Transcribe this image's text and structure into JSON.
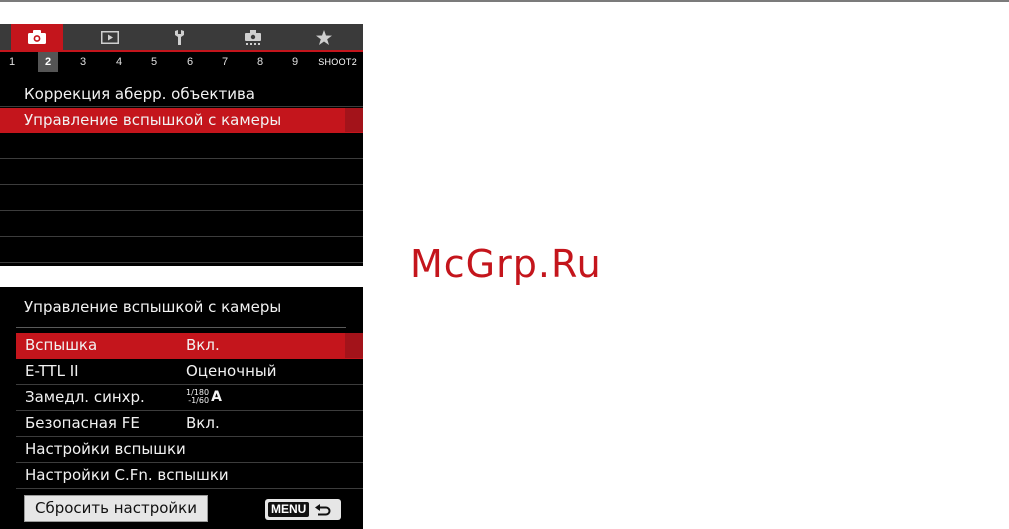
{
  "menu": {
    "tabs": [
      {
        "icon": "camera-icon",
        "active": true
      },
      {
        "icon": "playback-icon",
        "active": false
      },
      {
        "icon": "wrench-icon",
        "active": false
      },
      {
        "icon": "custom-function-icon",
        "active": false
      },
      {
        "icon": "star-icon",
        "active": false
      }
    ],
    "page_numbers": [
      "1",
      "2",
      "3",
      "4",
      "5",
      "6",
      "7",
      "8",
      "9"
    ],
    "active_page": "2",
    "page_name": "SHOOT2",
    "items": [
      "Коррекция аберр. объектива",
      "Управление вспышкой с камеры",
      "",
      "",
      "",
      "",
      ""
    ],
    "selected_index": 1
  },
  "flash_screen": {
    "title": "Управление вспышкой с камеры",
    "rows": [
      {
        "label": "Вспышка",
        "value": "Вкл."
      },
      {
        "label": "E-TTL II",
        "value": "Оценочный"
      },
      {
        "label": "Замедл. синхр.",
        "value_top": "1/180",
        "value_bottom": "-1/60",
        "value_suffix": "A"
      },
      {
        "label": "Безопасная FE",
        "value": "Вкл."
      },
      {
        "label": "Настройки вспышки",
        "value": ""
      },
      {
        "label": "Настройки C.Fn. вспышки",
        "value": ""
      }
    ],
    "reset_label": "Сбросить настройки",
    "menu_label": "MENU",
    "back_icon": "back-arrow-icon"
  },
  "watermark": "McGrp.Ru",
  "colors": {
    "accent": "#c4151c",
    "background": "#000000",
    "text": "#f2f2f2"
  }
}
